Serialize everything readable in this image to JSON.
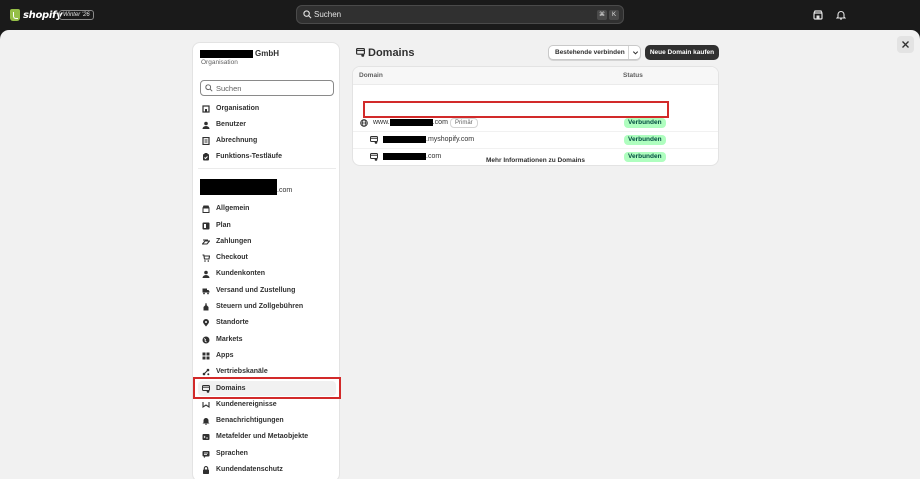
{
  "topbar": {
    "brand": "shopify",
    "edition": "Winter '26",
    "search_placeholder": "Suchen",
    "kbd_cmd": "⌘",
    "kbd_k": "K",
    "icons": [
      "store-icon",
      "bell-icon"
    ]
  },
  "sidebar": {
    "org_suffix": "GmbH",
    "org_sub": "Organisation",
    "search_placeholder": "Suchen",
    "org_items": [
      {
        "label": "Organisation",
        "icon": "organization-icon"
      },
      {
        "label": "Benutzer",
        "icon": "user-icon"
      },
      {
        "label": "Abrechnung",
        "icon": "billing-icon"
      },
      {
        "label": "Funktions-Testläufe",
        "icon": "feature-preview-icon"
      }
    ],
    "store_domain_suffix": ".com",
    "store_items": [
      {
        "label": "Allgemein",
        "icon": "store-icon"
      },
      {
        "label": "Plan",
        "icon": "plan-icon"
      },
      {
        "label": "Zahlungen",
        "icon": "payments-icon"
      },
      {
        "label": "Checkout",
        "icon": "cart-icon"
      },
      {
        "label": "Kundenkonten",
        "icon": "person-icon"
      },
      {
        "label": "Versand und Zustellung",
        "icon": "truck-icon"
      },
      {
        "label": "Steuern und Zollgebühren",
        "icon": "tax-icon"
      },
      {
        "label": "Standorte",
        "icon": "location-icon"
      },
      {
        "label": "Markets",
        "icon": "globe-icon"
      },
      {
        "label": "Apps",
        "icon": "apps-icon"
      },
      {
        "label": "Vertriebskanäle",
        "icon": "sales-channels-icon"
      },
      {
        "label": "Domains",
        "icon": "domain-icon"
      },
      {
        "label": "Kundenereignisse",
        "icon": "events-icon"
      },
      {
        "label": "Benachrichtigungen",
        "icon": "bell-icon"
      },
      {
        "label": "Metafelder und Metaobjekte",
        "icon": "metafields-icon"
      },
      {
        "label": "Sprachen",
        "icon": "languages-icon"
      },
      {
        "label": "Kundendatenschutz",
        "icon": "lock-icon"
      }
    ],
    "active_item": "Domains"
  },
  "main": {
    "title": "Domains",
    "connect_button": "Bestehende verbinden",
    "buy_button": "Neue Domain kaufen",
    "columns": {
      "domain": "Domain",
      "status": "Status"
    },
    "rows": [
      {
        "prefix": "www.",
        "suffix": ".com",
        "badge": "Primär",
        "status": "Verbunden",
        "icon": "globe-icon"
      },
      {
        "prefix": "",
        "suffix": ".myshopify.com",
        "badge": "",
        "status": "Verbunden",
        "icon": "domain-icon"
      },
      {
        "prefix": "",
        "suffix": ".com",
        "badge": "",
        "status": "Verbunden",
        "icon": "domain-icon"
      }
    ],
    "more_info": "Mehr Informationen zu Domains"
  },
  "colors": {
    "topbar": "#1a1a1a",
    "highlight": "#d22a2a",
    "status_bg": "#affebf",
    "status_text": "#014b40",
    "primary_button": "#303030"
  }
}
